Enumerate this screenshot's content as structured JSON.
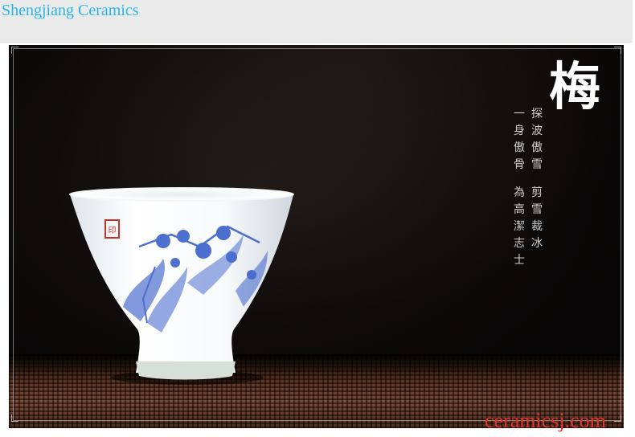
{
  "header": {
    "brand": "Shengjiang Ceramics"
  },
  "photo": {
    "title_char": "梅",
    "poem_columns": [
      "探\n波\n傲\n雪",
      "一\n身\n傲\n骨",
      "剪\n雪\n裁\n冰",
      "為\n高\n潔\n志\n士"
    ],
    "seal_text": "印",
    "colors": {
      "cup_blue": "#2f57c8",
      "seal_red": "#c2352a",
      "background": "#0a0807"
    }
  },
  "watermark": "ceramicsj.com"
}
